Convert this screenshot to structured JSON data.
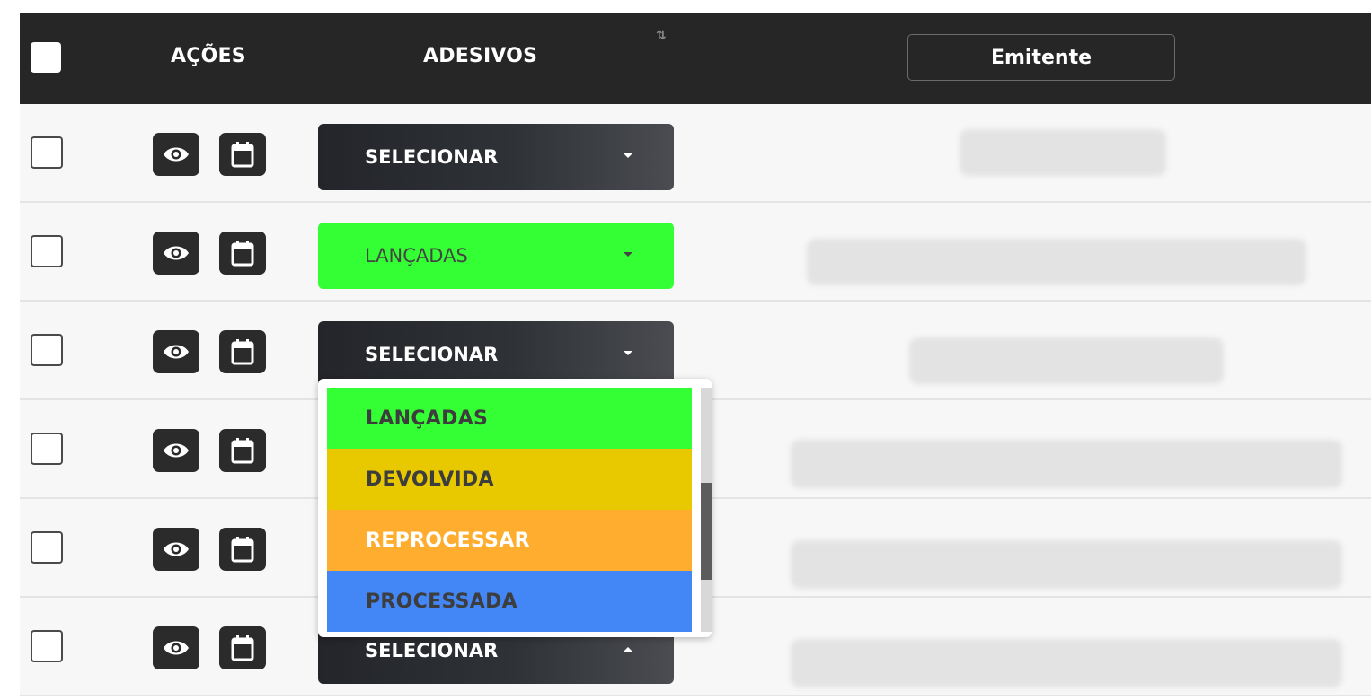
{
  "header": {
    "acoes_label": "AÇÕES",
    "adesivos_label": "ADESIVOS",
    "sort_glyph": "⇅",
    "emitente_label": "Emitente"
  },
  "rows": [
    {
      "sticker_label": "SELECIONAR",
      "sticker_style": "dark",
      "caret": "down"
    },
    {
      "sticker_label": "LANÇADAS",
      "sticker_style": "green",
      "caret": "down"
    },
    {
      "sticker_label": "SELECIONAR",
      "sticker_style": "dark",
      "caret": "down"
    },
    {
      "sticker_label": "",
      "sticker_style": "hidden",
      "caret": ""
    },
    {
      "sticker_label": "",
      "sticker_style": "hidden",
      "caret": ""
    },
    {
      "sticker_label": "SELECIONAR",
      "sticker_style": "dark",
      "caret": "up"
    }
  ],
  "dropdown": {
    "options": [
      {
        "label": "LANÇADAS",
        "bg": "#34ff34",
        "color": "#3d3d3d"
      },
      {
        "label": "DEVOLVIDA",
        "bg": "#e8c900",
        "color": "#3d3d3d"
      },
      {
        "label": "REPROCESSAR",
        "bg": "#ffad2e",
        "color": "#ffffff"
      },
      {
        "label": "PROCESSADA",
        "bg": "#4287f5",
        "color": "#3d3d3d"
      }
    ]
  },
  "icons": {
    "view": "eye-icon",
    "calendar": "calendar-icon"
  },
  "colors": {
    "header_bg": "#262626",
    "row_bg": "#f7f7f7",
    "dark_button": "#2b2b2b"
  }
}
